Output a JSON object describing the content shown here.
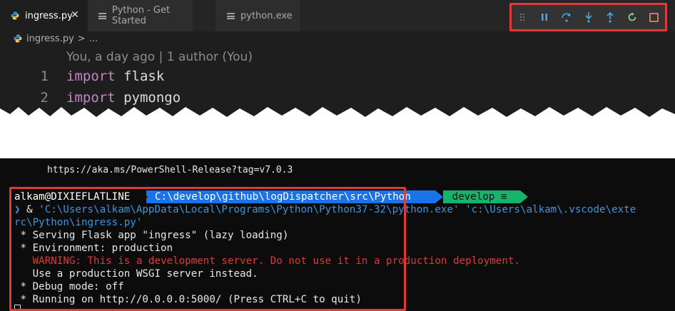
{
  "colors": {
    "editor_bg": "#1e1e1e",
    "terminal_bg": "#0c0c0c",
    "highlight_border": "#e0393a",
    "path_segment": "#1a73e8",
    "git_segment": "#17b26b",
    "keyword": "#c586c0",
    "string": "#3a96dd",
    "warning": "#e0393a"
  },
  "tabs": [
    {
      "label": "ingress.py",
      "icon": "python-icon",
      "active": true,
      "close": "✕"
    },
    {
      "label": "Python - Get Started",
      "icon": "preview-icon",
      "active": false
    },
    {
      "label": "python.exe",
      "icon": "file-icon",
      "active": false
    }
  ],
  "debug_toolbar": {
    "buttons": [
      {
        "name": "drag-handle-icon",
        "label": "Drag"
      },
      {
        "name": "pause-icon",
        "label": "Pause"
      },
      {
        "name": "step-over-icon",
        "label": "Step Over"
      },
      {
        "name": "step-into-icon",
        "label": "Step Into"
      },
      {
        "name": "step-out-icon",
        "label": "Step Out"
      },
      {
        "name": "restart-icon",
        "label": "Restart"
      },
      {
        "name": "stop-icon",
        "label": "Stop"
      }
    ]
  },
  "breadcrumb": {
    "file": "ingress.py",
    "separator": ">",
    "more": "..."
  },
  "codelens": "You, a day ago | 1 author (You)",
  "code": [
    {
      "line": "1",
      "keyword": "import",
      "rest": " flask"
    },
    {
      "line": "2",
      "keyword": "import",
      "rest": " pymongo"
    }
  ],
  "terminal": {
    "release_url": "https://aka.ms/PowerShell-Release?tag=v7.0.3",
    "prompt_user": "alkam@DIXIEFLATLINE",
    "prompt_path": "C:\\develop\\github\\logDispatcher\\src\\Python",
    "prompt_branch_icon": "",
    "prompt_branch": "develop ≡",
    "command_caret": "❯",
    "command_amp": " & ",
    "command_line1": "'C:\\Users\\alkam\\AppData\\Local\\Programs\\Python\\Python37-32\\python.exe' 'c:\\Users\\alkam\\.vscode\\exte",
    "command_line2": "rc\\Python\\ingress.py'",
    "output": [
      {
        "text": " * Serving Flask app \"ingress\" (lazy loading)",
        "type": "normal"
      },
      {
        "text": " * Environment: production",
        "type": "normal"
      },
      {
        "text": "   WARNING: This is a development server. Do not use it in a production deployment.",
        "type": "warning"
      },
      {
        "text": "   Use a production WSGI server instead.",
        "type": "normal"
      },
      {
        "text": " * Debug mode: off",
        "type": "normal"
      },
      {
        "text": " * Running on http://0.0.0.0:5000/ (Press CTRL+C to quit)",
        "type": "normal"
      }
    ]
  }
}
